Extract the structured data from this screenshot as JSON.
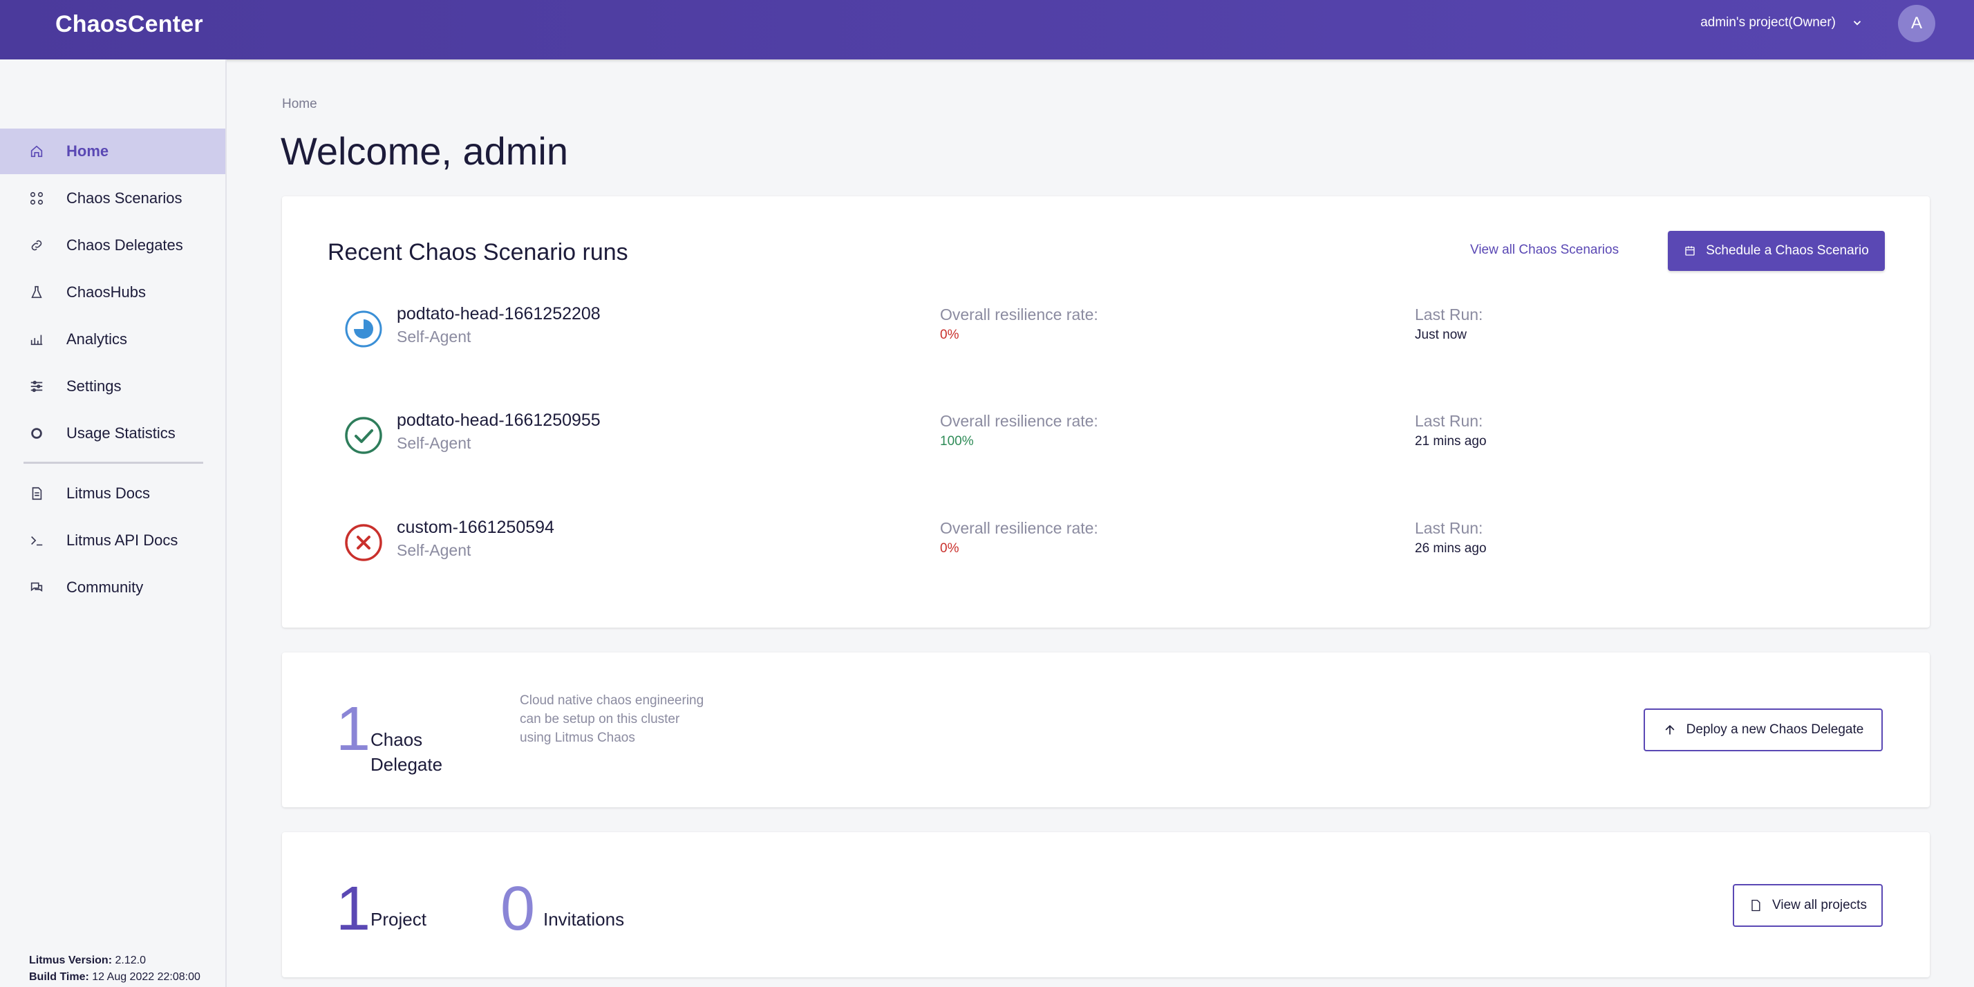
{
  "header": {
    "brand": "ChaosCenter",
    "project_selector": "admin's project(Owner)",
    "avatar_initial": "A"
  },
  "sidebar": {
    "items": [
      {
        "label": "Home",
        "icon": "home-icon",
        "active": true
      },
      {
        "label": "Chaos Scenarios",
        "icon": "grid-icon"
      },
      {
        "label": "Chaos Delegates",
        "icon": "link-icon"
      },
      {
        "label": "ChaosHubs",
        "icon": "flask-icon"
      },
      {
        "label": "Analytics",
        "icon": "bar-chart-icon"
      },
      {
        "label": "Settings",
        "icon": "sliders-icon"
      },
      {
        "label": "Usage Statistics",
        "icon": "circle-icon"
      }
    ],
    "links": [
      {
        "label": "Litmus Docs",
        "icon": "document-icon"
      },
      {
        "label": "Litmus API Docs",
        "icon": "terminal-icon"
      },
      {
        "label": "Community",
        "icon": "chat-icon"
      }
    ],
    "version_label": "Litmus Version:",
    "version_value": "2.12.0",
    "build_label": "Build Time:",
    "build_value": "12 Aug 2022 22:08:00"
  },
  "main": {
    "breadcrumb": "Home",
    "title": "Welcome, admin"
  },
  "recent_runs": {
    "title": "Recent Chaos Scenario runs",
    "view_all_label": "View all Chaos Scenarios",
    "schedule_label": "Schedule a Chaos Scenario",
    "resilience_label": "Overall resilience rate:",
    "last_run_label": "Last Run:",
    "runs": [
      {
        "name": "podtato-head-1661252208",
        "agent": "Self-Agent",
        "resilience": "0%",
        "last_run": "Just now",
        "status": "running",
        "status_color": "#3a8fd6"
      },
      {
        "name": "podtato-head-1661250955",
        "agent": "Self-Agent",
        "resilience": "100%",
        "last_run": "21 mins ago",
        "status": "succeeded",
        "status_color": "#2e7d5b"
      },
      {
        "name": "custom-1661250594",
        "agent": "Self-Agent",
        "resilience": "0%",
        "last_run": "26 mins ago",
        "status": "failed",
        "status_color": "#c9302c"
      }
    ]
  },
  "delegates": {
    "count": "1",
    "label": "Chaos Delegate",
    "description": "Cloud native chaos engineering can be setup on this cluster using Litmus Chaos",
    "deploy_label": "Deploy a new Chaos Delegate"
  },
  "projects": {
    "project_count": "1",
    "project_label": "Project",
    "invitation_count": "0",
    "invitation_label": "Invitations",
    "view_all_label": "View all projects"
  },
  "colors": {
    "header": "#4b3a9c",
    "accent": "#5a48b4",
    "active_nav_bg": "#cfcdec",
    "error": "#c9302c",
    "success": "#2e8b57"
  }
}
